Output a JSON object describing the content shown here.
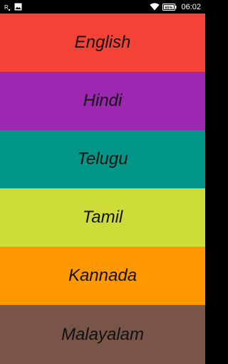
{
  "status_bar": {
    "time": "06:02",
    "battery_percent": "65%",
    "icons": [
      "sim-r-icon",
      "image-notification-icon",
      "wifi-icon",
      "battery-icon"
    ]
  },
  "languages": [
    {
      "label": "English",
      "color": "#F44336"
    },
    {
      "label": "Hindi",
      "color": "#9C27B0"
    },
    {
      "label": "Telugu",
      "color": "#009688"
    },
    {
      "label": "Tamil",
      "color": "#CDDC39"
    },
    {
      "label": "Kannada",
      "color": "#FF9800"
    },
    {
      "label": "Malayalam",
      "color": "#795548"
    }
  ]
}
